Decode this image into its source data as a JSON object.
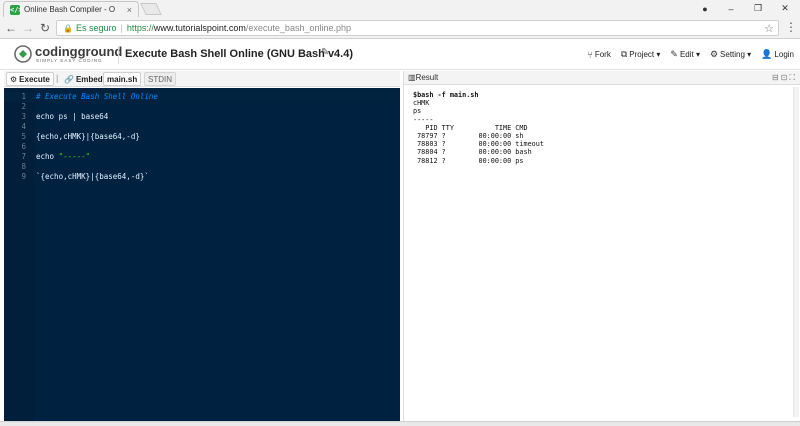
{
  "browser": {
    "tab_title": "Online Bash Compiler - O",
    "tab_close": "×",
    "secure_label": "Es seguro",
    "url_scheme": "https://",
    "url_domain": "www.tutorialspoint.com",
    "url_path": "/execute_bash_online.php",
    "window_min": "–",
    "window_max": "❐",
    "window_close": "✕",
    "user_glyph": "●"
  },
  "header": {
    "logo_text": "codingground",
    "logo_tagline": "SIMPLY EASY CODING",
    "title": "Execute Bash Shell Online (GNU Bash v4.4)",
    "toolbar": [
      {
        "icon": "fork-icon",
        "glyph": "⑂",
        "label": "Fork"
      },
      {
        "icon": "project-icon",
        "glyph": "⧉",
        "label": "Project ▾"
      },
      {
        "icon": "edit-icon",
        "glyph": "✎",
        "label": "Edit ▾"
      },
      {
        "icon": "gear-icon",
        "glyph": "⚙",
        "label": "Setting ▾"
      },
      {
        "icon": "user-icon",
        "glyph": "👤",
        "label": "Login"
      }
    ]
  },
  "editor_bar": {
    "execute_label": "Execute",
    "embed_label": "Embed",
    "file_tab": "main.sh",
    "stdin_tab": "STDIN"
  },
  "editor": {
    "lines": [
      {
        "n": "1",
        "text": "# Execute Bash Shell Online",
        "kind": "comment"
      },
      {
        "n": "2",
        "text": "",
        "kind": "plain"
      },
      {
        "n": "3",
        "text": "echo ps | base64",
        "kind": "plain"
      },
      {
        "n": "4",
        "text": "",
        "kind": "plain"
      },
      {
        "n": "5",
        "text": "{echo,cHMK}|{base64,-d}",
        "kind": "plain"
      },
      {
        "n": "6",
        "text": "",
        "kind": "plain"
      },
      {
        "n": "7",
        "text": "echo \"-----\"",
        "kind": "plain"
      },
      {
        "n": "8",
        "text": "",
        "kind": "plain"
      },
      {
        "n": "9",
        "text": "`{echo,cHMK}|{base64,-d}`",
        "kind": "plain"
      }
    ]
  },
  "result": {
    "label": "Result",
    "command": "$bash -f main.sh",
    "output": "cHMK\nps\n-----\n   PID TTY          TIME CMD\n 78797 ?        00:00:00 sh\n 78803 ?        00:00:00 timeout\n 78804 ?        00:00:00 bash\n 78812 ?        00:00:00 ps"
  },
  "colors": {
    "editor_bg": "#002240",
    "comment": "#0088ff",
    "string": "#3ad900",
    "code_text": "#e1efff"
  }
}
